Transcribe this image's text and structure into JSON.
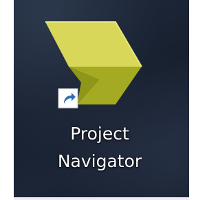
{
  "desktop": {
    "shortcut": {
      "label_line1": "Project",
      "label_line2": "Navigator",
      "icon": "chevron-arrow-icon",
      "badge_icon": "shortcut-arrow-icon",
      "colors": {
        "icon_top": "#d9d75a",
        "icon_bottom": "#9ea51e",
        "badge_bg": "#2f6fb8"
      }
    }
  }
}
